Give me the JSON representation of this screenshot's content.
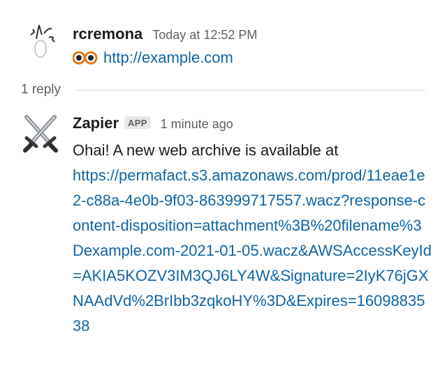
{
  "messages": [
    {
      "username": "rcremona",
      "timestamp": "Today at 12:52 PM",
      "emoji_icon": "eyes-emoji-icon",
      "link_text": "http://example.com"
    },
    {
      "username": "Zapier",
      "badge": "APP",
      "timestamp": "1 minute ago",
      "avatar_icon": "crossed-swords-icon",
      "text": "Ohai! A new web archive is available at",
      "link_text": "https://permafact.s3.amazonaws.com/prod/11eae1e2-c88a-4e0b-9f03-863999717557.wacz?response-content-disposition=attachment%3B%20filename%3Dexample.com-2021-01-05.wacz&AWSAccessKeyId=AKIA5KOZV3IM3QJ6LY4W&Signature=2IyK76jGXNAAdVd%2BrIbb3zqkoHY%3D&Expires=1609883538"
    }
  ],
  "thread": {
    "reply_count": "1 reply"
  },
  "colors": {
    "link": "#1264a3",
    "text": "#1d1c1d",
    "muted": "#616061",
    "badge_bg": "#e8e8e8",
    "divider": "#dddddd"
  }
}
